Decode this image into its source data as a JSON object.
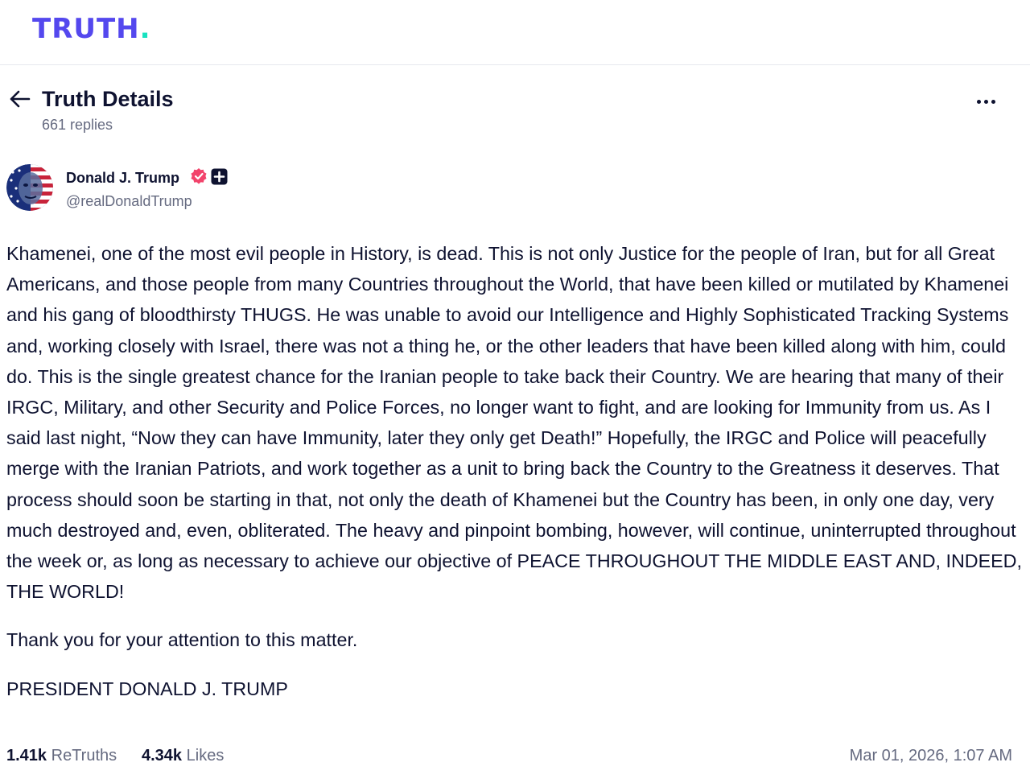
{
  "brand": {
    "logo_text": "TRUTH",
    "logo_dot": ".",
    "primary_color": "#5448ee",
    "accent_color": "#17e2c0"
  },
  "header": {
    "title": "Truth Details",
    "replies": "661 replies",
    "back_icon": "arrow-left-icon",
    "more_icon": "more-horizontal-icon"
  },
  "author": {
    "name": "Donald J. Trump",
    "handle": "@realDonaldTrump",
    "verified_color": "#f2436b"
  },
  "post": {
    "body": "Khamenei, one of the most evil people in History, is dead. This is not only Justice for the people of Iran, but for all Great Americans, and those people from many Countries throughout the World, that have been killed or mutilated by Khamenei and his gang of bloodthirsty THUGS. He was unable to avoid our Intelligence and Highly Sophisticated Tracking Systems and, working closely with Israel, there was not a thing he, or the other leaders that have been killed along with him, could do. This is the single greatest chance for the Iranian people to take back their Country. We are hearing that many of their IRGC, Military, and other Security and Police Forces, no longer want to fight, and are looking for Immunity from us. As I said last night, “Now they can have Immunity, later they only get Death!” Hopefully, the IRGC and Police will peacefully merge with the Iranian Patriots, and work together as a unit to bring back the Country to the Greatness it deserves. That process should soon be starting in that, not only the death of Khamenei but the Country has been, in only one day, very much destroyed and, even, obliterated. The heavy and pinpoint bombing, however, will continue, uninterrupted throughout the week or, as long as necessary to achieve our objective of PEACE THROUGHOUT THE MIDDLE EAST AND, INDEED, THE WORLD!",
    "thanks": "Thank you for your attention to this matter.",
    "signature": "PRESIDENT DONALD J. TRUMP"
  },
  "stats": {
    "retruths_count": "1.41k",
    "retruths_label": "ReTruths",
    "likes_count": "4.34k",
    "likes_label": "Likes",
    "timestamp": "Mar 01, 2026, 1:07 AM"
  }
}
